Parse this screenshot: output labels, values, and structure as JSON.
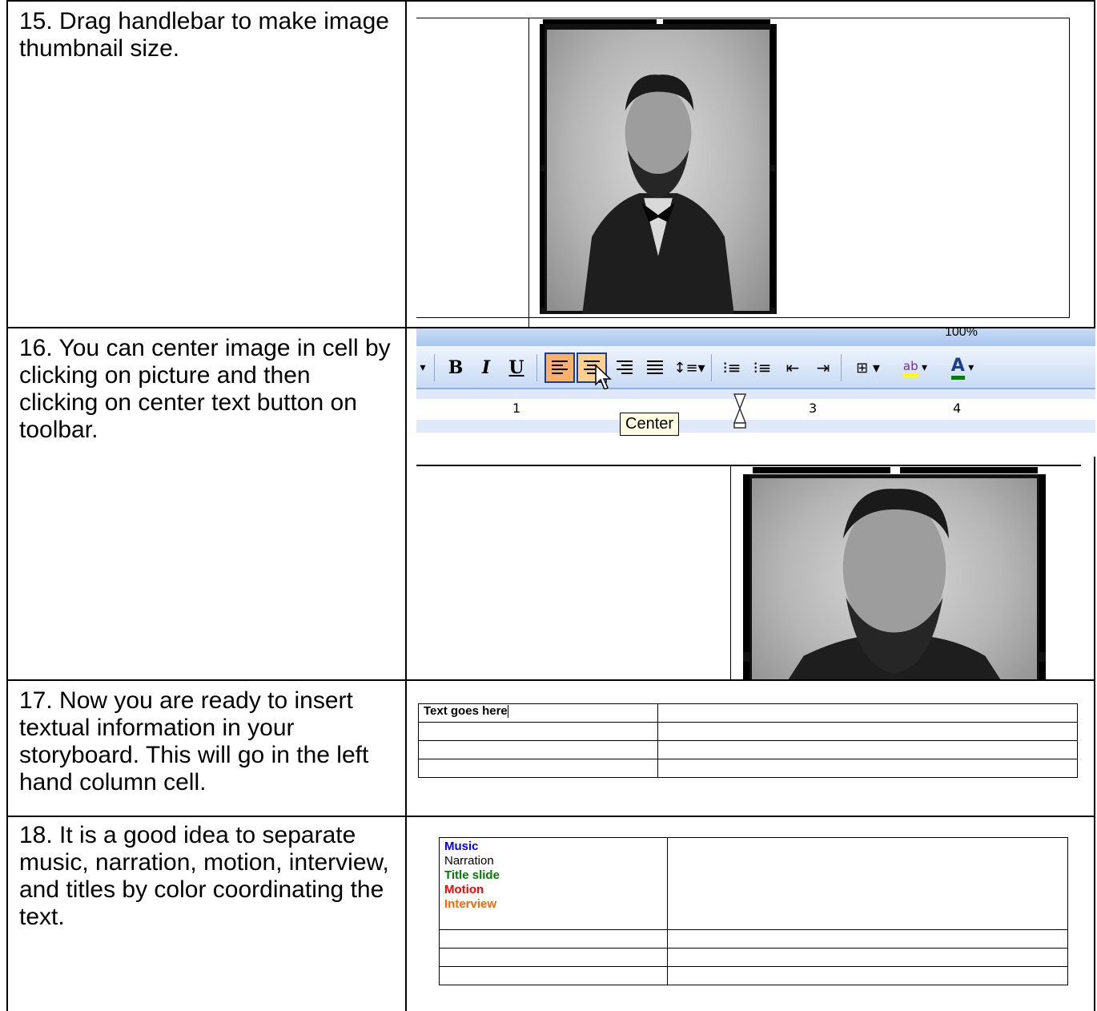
{
  "steps": [
    {
      "text": "15. Drag handlebar to make image thumbnail size."
    },
    {
      "text": "16. You can center image in cell by clicking on picture and then clicking on center text button on toolbar."
    },
    {
      "text": "17. Now you are ready to insert textual information in your storyboard.  This will go in the left hand column cell."
    },
    {
      "text": "18. It is a good idea to separate music, narration, motion, interview, and titles by color coordinating the text."
    }
  ],
  "toolbar": {
    "top_zoom": "100%",
    "bold": "B",
    "italic": "I",
    "underline": "U",
    "tooltip": "Center",
    "ruler": [
      "1",
      "3",
      "4"
    ],
    "icons": [
      "align-left-icon",
      "align-center-icon",
      "align-right-icon",
      "justify-icon",
      "line-spacing-icon",
      "numbering-icon",
      "bullets-icon",
      "decrease-indent-icon",
      "increase-indent-icon",
      "border-icon",
      "highlight-icon",
      "font-color-icon",
      "mouse-cursor-icon",
      "hourglass-icon"
    ]
  },
  "table17": {
    "rows": [
      [
        "Text goes here",
        ""
      ],
      [
        "",
        ""
      ],
      [
        "",
        ""
      ],
      [
        "",
        ""
      ]
    ]
  },
  "table18": {
    "entries": [
      {
        "label": "Music",
        "color": "#0000ff"
      },
      {
        "label": "Narration",
        "color": "#000000"
      },
      {
        "label": "Title slide",
        "color": "#008000"
      },
      {
        "label": "Motion",
        "color": "#ff0000"
      },
      {
        "label": "Interview",
        "color": "#ff6600"
      }
    ]
  },
  "colors": {
    "highlight": "#ffff00",
    "font_color": "#008000",
    "button_active": "#f9b169"
  }
}
